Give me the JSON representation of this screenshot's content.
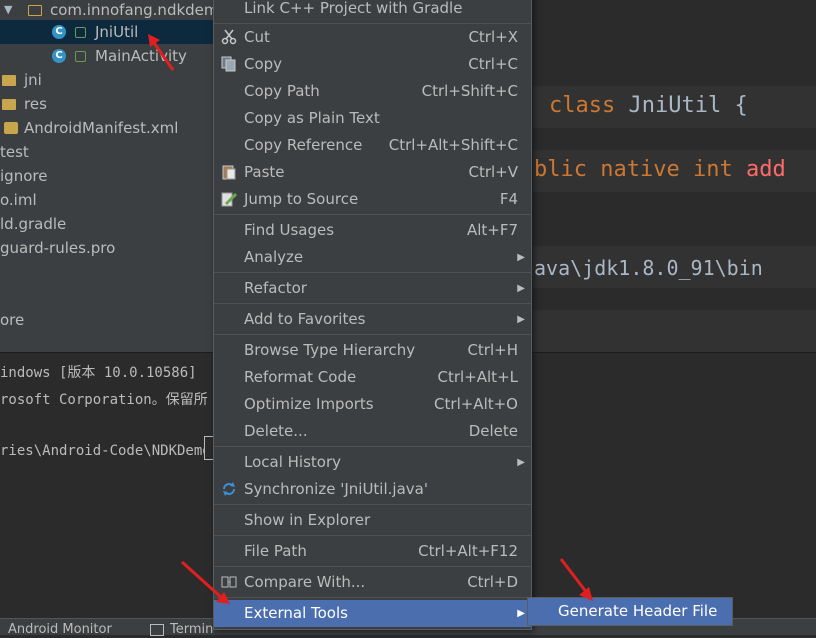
{
  "tree": {
    "items": [
      {
        "label": "com.innofang.ndkdem"
      },
      {
        "label": "JniUtil"
      },
      {
        "label": "MainActivity"
      },
      {
        "label": "jni"
      },
      {
        "label": "res"
      },
      {
        "label": "AndroidManifest.xml"
      },
      {
        "label": "test"
      },
      {
        "label": "ignore"
      },
      {
        "label": "o.iml"
      },
      {
        "label": "ld.gradle"
      },
      {
        "label": "guard-rules.pro"
      },
      {
        "label": "ore"
      }
    ]
  },
  "editor": {
    "line1": {
      "keyword": "class",
      "name": "JniUtil",
      "brace": "{"
    },
    "line2": {
      "kw1": "blic",
      "kw2": "native",
      "kw3": "int",
      "fn": "add"
    },
    "line3": "ava\\jdk1.8.0_91\\bin"
  },
  "terminal": {
    "lines": [
      "indows [版本 10.0.10586]",
      "rosoft Corporation。保留所",
      "ries\\Android-Code\\NDKDemo>"
    ]
  },
  "bottombar": {
    "tab1": "Android Monitor",
    "tab2": "Termin"
  },
  "menu": {
    "items": [
      {
        "label": "Link C++ Project with Gradle",
        "shortcut": ""
      },
      {
        "label": "Cut",
        "shortcut": "Ctrl+X"
      },
      {
        "label": "Copy",
        "shortcut": "Ctrl+C"
      },
      {
        "label": "Copy Path",
        "shortcut": "Ctrl+Shift+C"
      },
      {
        "label": "Copy as Plain Text",
        "shortcut": ""
      },
      {
        "label": "Copy Reference",
        "shortcut": "Ctrl+Alt+Shift+C"
      },
      {
        "label": "Paste",
        "shortcut": "Ctrl+V"
      },
      {
        "label": "Jump to Source",
        "shortcut": "F4"
      },
      {
        "label": "Find Usages",
        "shortcut": "Alt+F7"
      },
      {
        "label": "Analyze",
        "shortcut": ""
      },
      {
        "label": "Refactor",
        "shortcut": ""
      },
      {
        "label": "Add to Favorites",
        "shortcut": ""
      },
      {
        "label": "Browse Type Hierarchy",
        "shortcut": "Ctrl+H"
      },
      {
        "label": "Reformat Code",
        "shortcut": "Ctrl+Alt+L"
      },
      {
        "label": "Optimize Imports",
        "shortcut": "Ctrl+Alt+O"
      },
      {
        "label": "Delete...",
        "shortcut": "Delete"
      },
      {
        "label": "Local History",
        "shortcut": ""
      },
      {
        "label": "Synchronize 'JniUtil.java'",
        "shortcut": ""
      },
      {
        "label": "Show in Explorer",
        "shortcut": ""
      },
      {
        "label": "File Path",
        "shortcut": "Ctrl+Alt+F12"
      },
      {
        "label": "Compare With...",
        "shortcut": "Ctrl+D"
      },
      {
        "label": "External Tools",
        "shortcut": ""
      }
    ]
  },
  "submenu": {
    "label": "Generate Header File"
  },
  "colors": {
    "menu_bg": "#3c3f41",
    "highlight": "#4b6eaf",
    "annotation_arrow": "#e02020"
  }
}
